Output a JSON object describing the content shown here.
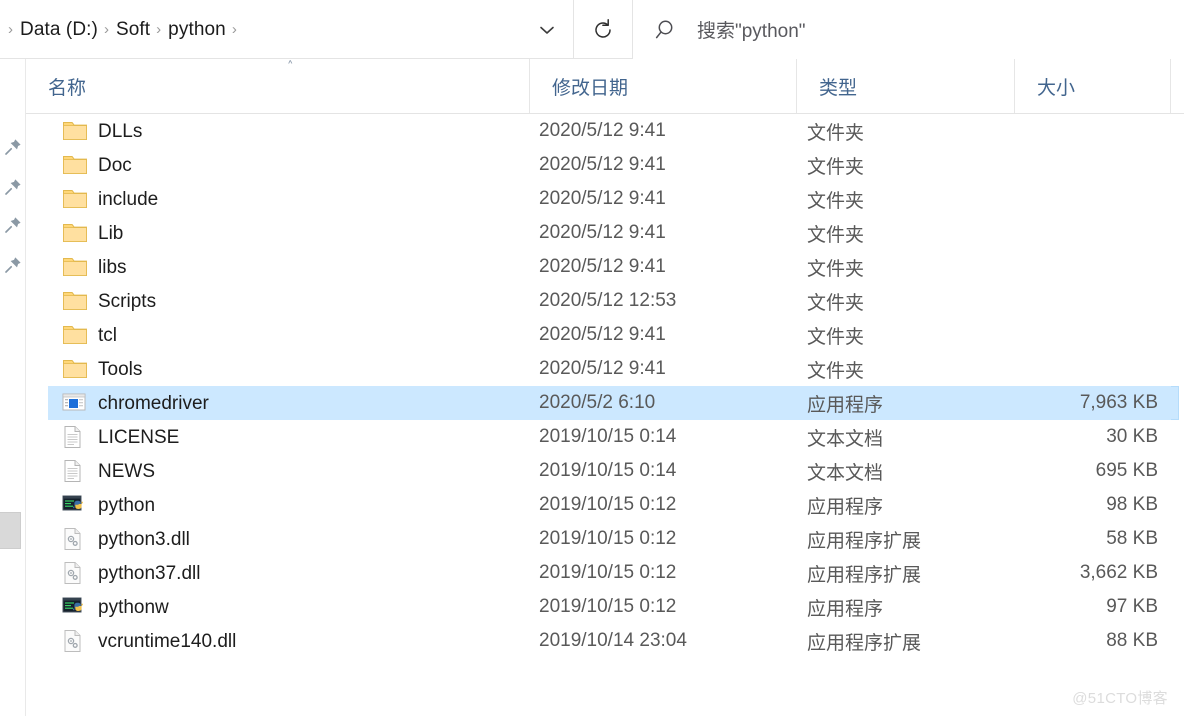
{
  "address": {
    "separator": "›",
    "crumbs": [
      "Data (D:)",
      "Soft",
      "python"
    ],
    "dropdown_icon": "chevron-down-icon",
    "refresh_icon": "refresh-icon"
  },
  "search": {
    "icon": "search-icon",
    "placeholder": "搜索\"python\"",
    "value": ""
  },
  "left_rail": {
    "pin_icon": "pushpin-icon",
    "pin_count": 4,
    "handle": "scroll-handle"
  },
  "columns": [
    {
      "label": "名称",
      "sorted": true,
      "sort_caret": "˄"
    },
    {
      "label": "修改日期",
      "sorted": false,
      "sort_caret": ""
    },
    {
      "label": "类型",
      "sorted": false,
      "sort_caret": ""
    },
    {
      "label": "大小",
      "sorted": false,
      "sort_caret": ""
    }
  ],
  "colors": {
    "selection": "#cce8ff",
    "selection_border": "#b5dcfb",
    "header_text": "#42658e",
    "folder": "#ffd778",
    "watermark": "#dcdcdc"
  },
  "rows": [
    {
      "name": "DLLs",
      "date": "2020/5/12 9:41",
      "type": "文件夹",
      "size": "",
      "icon": "folder-icon",
      "selected": false
    },
    {
      "name": "Doc",
      "date": "2020/5/12 9:41",
      "type": "文件夹",
      "size": "",
      "icon": "folder-icon",
      "selected": false
    },
    {
      "name": "include",
      "date": "2020/5/12 9:41",
      "type": "文件夹",
      "size": "",
      "icon": "folder-icon",
      "selected": false
    },
    {
      "name": "Lib",
      "date": "2020/5/12 9:41",
      "type": "文件夹",
      "size": "",
      "icon": "folder-icon",
      "selected": false
    },
    {
      "name": "libs",
      "date": "2020/5/12 9:41",
      "type": "文件夹",
      "size": "",
      "icon": "folder-icon",
      "selected": false
    },
    {
      "name": "Scripts",
      "date": "2020/5/12 12:53",
      "type": "文件夹",
      "size": "",
      "icon": "folder-icon",
      "selected": false
    },
    {
      "name": "tcl",
      "date": "2020/5/12 9:41",
      "type": "文件夹",
      "size": "",
      "icon": "folder-icon",
      "selected": false
    },
    {
      "name": "Tools",
      "date": "2020/5/12 9:41",
      "type": "文件夹",
      "size": "",
      "icon": "folder-icon",
      "selected": false
    },
    {
      "name": "chromedriver",
      "date": "2020/5/2 6:10",
      "type": "应用程序",
      "size": "7,963 KB",
      "icon": "application-icon",
      "selected": true
    },
    {
      "name": "LICENSE",
      "date": "2019/10/15 0:14",
      "type": "文本文档",
      "size": "30 KB",
      "icon": "text-file-icon",
      "selected": false
    },
    {
      "name": "NEWS",
      "date": "2019/10/15 0:14",
      "type": "文本文档",
      "size": "695 KB",
      "icon": "text-file-icon",
      "selected": false
    },
    {
      "name": "python",
      "date": "2019/10/15 0:12",
      "type": "应用程序",
      "size": "98 KB",
      "icon": "python-exe-icon",
      "selected": false
    },
    {
      "name": "python3.dll",
      "date": "2019/10/15 0:12",
      "type": "应用程序扩展",
      "size": "58 KB",
      "icon": "dll-file-icon",
      "selected": false
    },
    {
      "name": "python37.dll",
      "date": "2019/10/15 0:12",
      "type": "应用程序扩展",
      "size": "3,662 KB",
      "icon": "dll-file-icon",
      "selected": false
    },
    {
      "name": "pythonw",
      "date": "2019/10/15 0:12",
      "type": "应用程序",
      "size": "97 KB",
      "icon": "python-exe-icon",
      "selected": false
    },
    {
      "name": "vcruntime140.dll",
      "date": "2019/10/14 23:04",
      "type": "应用程序扩展",
      "size": "88 KB",
      "icon": "dll-file-icon",
      "selected": false
    }
  ],
  "watermark": {
    "text": "@51CTO博客"
  }
}
